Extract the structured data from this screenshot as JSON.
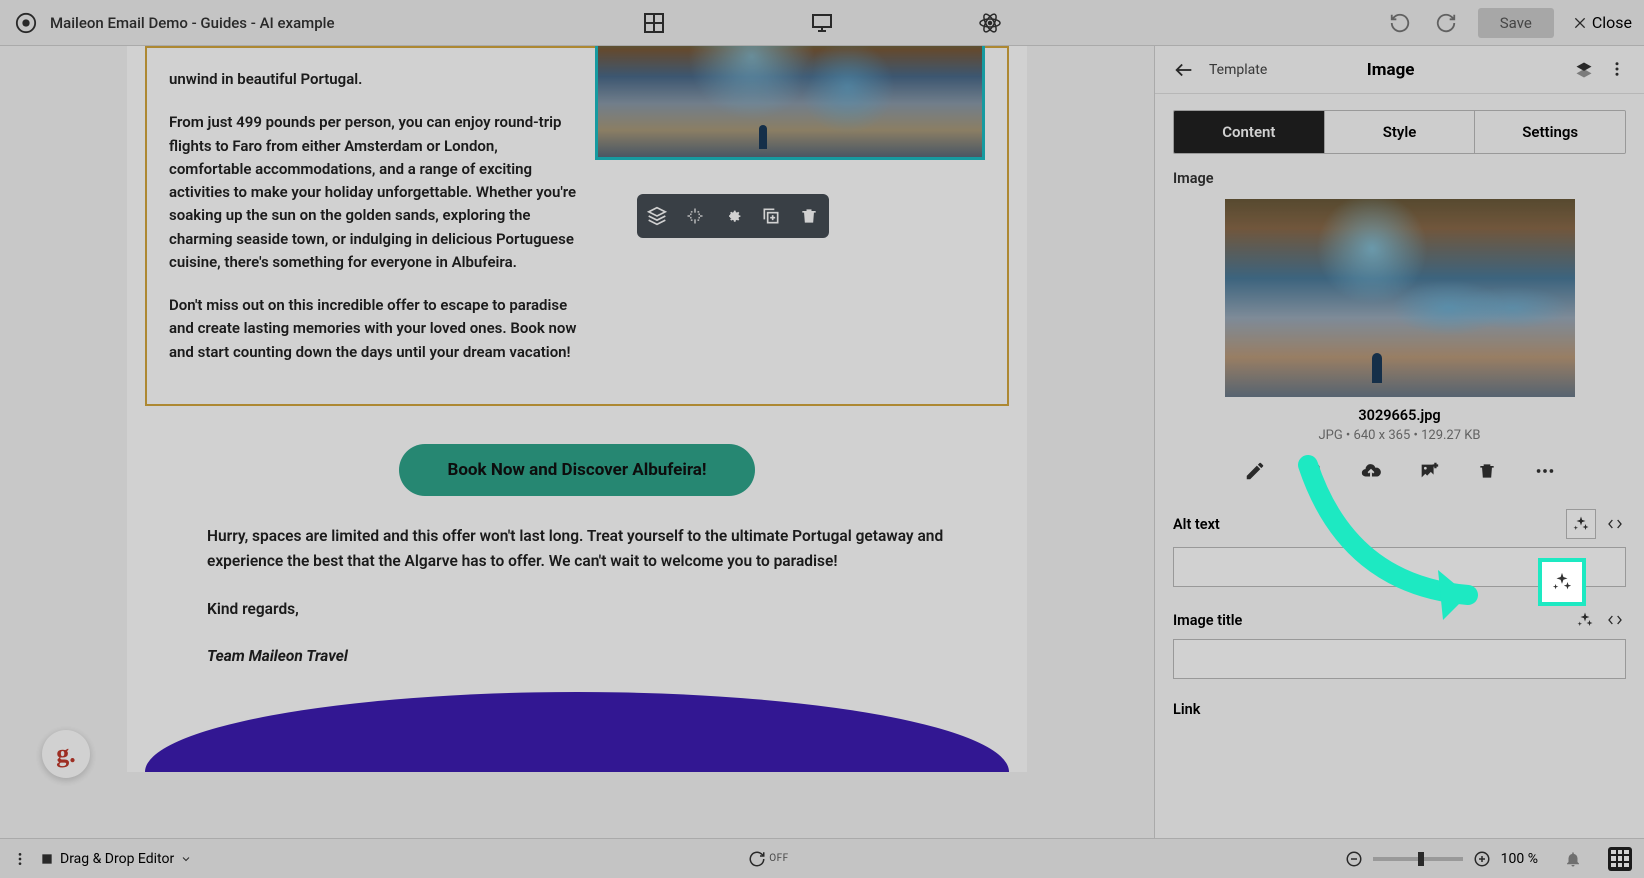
{
  "topbar": {
    "title": "Maileon Email Demo - Guides - AI example",
    "save": "Save",
    "close": "Close"
  },
  "email": {
    "para_intro_tail": "unwind in beautiful Portugal.",
    "para_offer": "From just 499 pounds per person, you can enjoy round-trip flights to Faro from either Amsterdam or London, comfortable accommodations, and a range of exciting activities to make your holiday unforgettable. Whether you're soaking up the sun on the golden sands, exploring the charming seaside town, or indulging in delicious Portuguese cuisine, there's something for everyone in Albufeira.",
    "para_urgency": "Don't miss out on this incredible offer to escape to paradise and create lasting memories with your loved ones. Book now and start counting down the days until your dream vacation!",
    "cta": "Book Now and Discover Albufeira!",
    "outro": "Hurry, spaces are limited and this offer won't last long. Treat yourself to the ultimate Portugal getaway and experience the best that the Algarve has to offer. We can't wait to welcome you to paradise!",
    "regards": "Kind regards,",
    "signature": "Team Maileon Travel"
  },
  "panel": {
    "back_crumb": "Template",
    "heading": "Image",
    "tabs": {
      "content": "Content",
      "style": "Style",
      "settings": "Settings"
    },
    "image_label": "Image",
    "filename": "3029665.jpg",
    "filemeta": "JPG • 640 x 365 • 129.27 KB",
    "alt_label": "Alt text",
    "alt_value": "",
    "title_label": "Image title",
    "title_value": "",
    "link_label": "Link"
  },
  "bottombar": {
    "editor": "Drag & Drop Editor",
    "off": "OFF",
    "zoom": "100 %"
  },
  "badge": "g."
}
